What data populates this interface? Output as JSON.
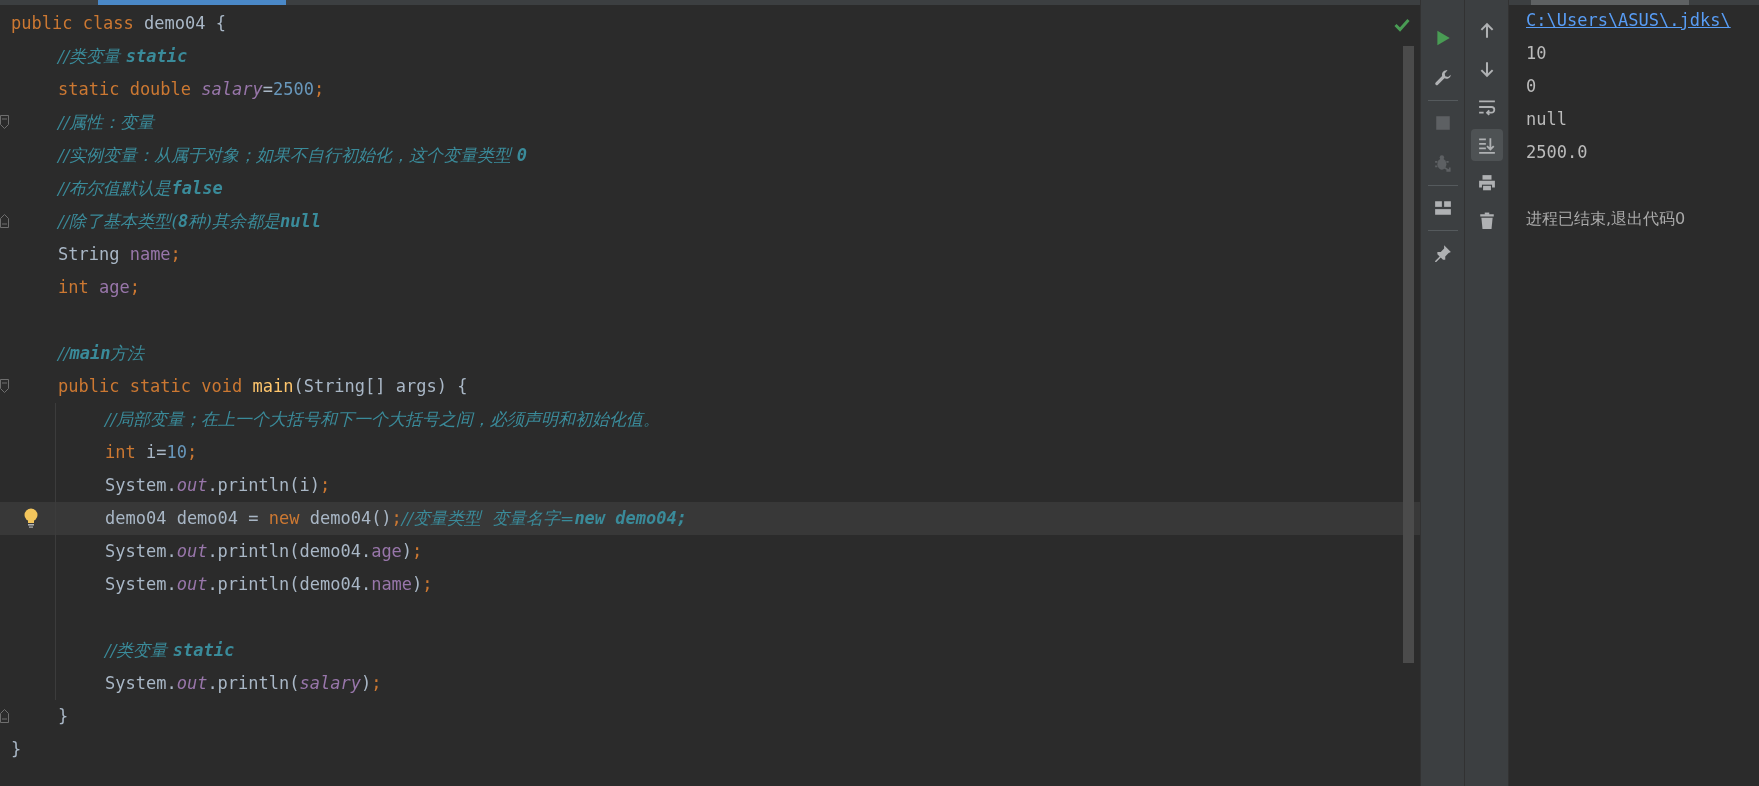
{
  "editor": {
    "lines": [
      {
        "tokens": [
          {
            "kind": "kw",
            "text": "public class "
          },
          {
            "kind": "plain",
            "text": "demo04 {"
          }
        ],
        "children": [
          {
            "tokens": [
              {
                "kind": "comment",
                "text": "//类变量 **static**"
              }
            ]
          },
          {
            "tokens": [
              {
                "kind": "kw",
                "text": "static double "
              },
              {
                "kind": "static_field",
                "text": "salary"
              },
              {
                "kind": "plain",
                "text": "="
              },
              {
                "kind": "num",
                "text": "2500"
              },
              {
                "kind": "kw",
                "text": ";"
              }
            ]
          },
          {
            "tokens": [
              {
                "kind": "comment",
                "text": "//属性：变量"
              }
            ],
            "fold_start": true
          },
          {
            "tokens": [
              {
                "kind": "comment",
                "text": "//实例变量：从属于对象；如果不自行初始化，这个变量类型 **0**"
              }
            ]
          },
          {
            "tokens": [
              {
                "kind": "comment",
                "text": "//布尔值默认是**false**"
              }
            ]
          },
          {
            "tokens": [
              {
                "kind": "comment",
                "text": "//除了基本类型(**8**种)其余都是**null**"
              }
            ],
            "fold_end": true
          },
          {
            "tokens": [
              {
                "kind": "plain",
                "text": "String "
              },
              {
                "kind": "field",
                "text": "name"
              },
              {
                "kind": "kw",
                "text": ";"
              }
            ]
          },
          {
            "tokens": [
              {
                "kind": "kw",
                "text": "int "
              },
              {
                "kind": "field",
                "text": "age"
              },
              {
                "kind": "kw",
                "text": ";"
              }
            ]
          },
          {
            "tokens": [
              {
                "kind": "comment",
                "text": "//**main**方法"
              }
            ],
            "blank_before": true
          },
          {
            "tokens": [
              {
                "kind": "kw",
                "text": "public static void "
              },
              {
                "kind": "method",
                "text": "main"
              },
              {
                "kind": "plain",
                "text": "(String[] args) {"
              }
            ],
            "fold_start": true,
            "children": [
              {
                "tokens": [
                  {
                    "kind": "comment",
                    "text": "//局部变量；在上一个大括号和下一个大括号之间，必须声明和初始化值。"
                  }
                ]
              },
              {
                "tokens": [
                  {
                    "kind": "kw",
                    "text": "int "
                  },
                  {
                    "kind": "plain",
                    "text": "i="
                  },
                  {
                    "kind": "num",
                    "text": "10"
                  },
                  {
                    "kind": "kw",
                    "text": ";"
                  }
                ]
              },
              {
                "tokens": [
                  {
                    "kind": "plain",
                    "text": "System."
                  },
                  {
                    "kind": "static_field",
                    "text": "out"
                  },
                  {
                    "kind": "plain",
                    "text": ".println(i)"
                  },
                  {
                    "kind": "kw",
                    "text": ";"
                  }
                ]
              },
              {
                "tokens": [
                  {
                    "kind": "plain",
                    "text": "demo04 demo04 = "
                  },
                  {
                    "kind": "kw",
                    "text": "new "
                  },
                  {
                    "kind": "plain",
                    "text": "demo04()"
                  },
                  {
                    "kind": "kw",
                    "text": ";"
                  },
                  {
                    "kind": "comment",
                    "text": "//变量类型  变量名字=**new demo04;**"
                  }
                ],
                "highlighted": true,
                "bulb": true
              },
              {
                "tokens": [
                  {
                    "kind": "plain",
                    "text": "System."
                  },
                  {
                    "kind": "static_field",
                    "text": "out"
                  },
                  {
                    "kind": "plain",
                    "text": ".println(demo04."
                  },
                  {
                    "kind": "field",
                    "text": "age"
                  },
                  {
                    "kind": "plain",
                    "text": ")"
                  },
                  {
                    "kind": "kw",
                    "text": ";"
                  }
                ]
              },
              {
                "tokens": [
                  {
                    "kind": "plain",
                    "text": "System."
                  },
                  {
                    "kind": "static_field",
                    "text": "out"
                  },
                  {
                    "kind": "plain",
                    "text": ".println(demo04."
                  },
                  {
                    "kind": "field",
                    "text": "name"
                  },
                  {
                    "kind": "plain",
                    "text": ")"
                  },
                  {
                    "kind": "kw",
                    "text": ";"
                  }
                ]
              },
              {
                "tokens": [
                  {
                    "kind": "comment",
                    "text": "//类变量 **static**"
                  }
                ],
                "blank_before": true
              },
              {
                "tokens": [
                  {
                    "kind": "plain",
                    "text": "System."
                  },
                  {
                    "kind": "static_field",
                    "text": "out"
                  },
                  {
                    "kind": "plain",
                    "text": ".println("
                  },
                  {
                    "kind": "static_field",
                    "text": "salary"
                  },
                  {
                    "kind": "plain",
                    "text": ")"
                  },
                  {
                    "kind": "kw",
                    "text": ";"
                  }
                ]
              }
            ]
          },
          {
            "tokens": [
              {
                "kind": "plain",
                "text": "}"
              }
            ],
            "fold_end": true
          }
        ]
      },
      {
        "tokens": [
          {
            "kind": "plain",
            "text": "}"
          }
        ]
      }
    ]
  },
  "run_toolbar": [
    {
      "kind": "run",
      "disabled": false
    },
    {
      "kind": "wrench",
      "disabled": false
    },
    {
      "kind": "separator"
    },
    {
      "kind": "stop",
      "disabled": true
    },
    {
      "kind": "bug",
      "disabled": true
    },
    {
      "kind": "separator"
    },
    {
      "kind": "layout",
      "disabled": false
    },
    {
      "kind": "separator"
    },
    {
      "kind": "pin",
      "disabled": false
    }
  ],
  "console_toolbar": [
    {
      "kind": "up",
      "selected": false
    },
    {
      "kind": "down",
      "selected": false
    },
    {
      "kind": "wrap",
      "selected": false
    },
    {
      "kind": "scroll_end",
      "selected": true
    },
    {
      "kind": "print",
      "selected": false
    },
    {
      "kind": "trash",
      "selected": false
    }
  ],
  "console": [
    {
      "kind": "link",
      "text": "C:\\Users\\ASUS\\.jdks\\"
    },
    {
      "kind": "text",
      "text": "10"
    },
    {
      "kind": "text",
      "text": "0"
    },
    {
      "kind": "text",
      "text": "null"
    },
    {
      "kind": "text",
      "text": "2500.0"
    },
    {
      "kind": "blank"
    },
    {
      "kind": "status",
      "text": "进程已结束,退出代码0"
    }
  ]
}
